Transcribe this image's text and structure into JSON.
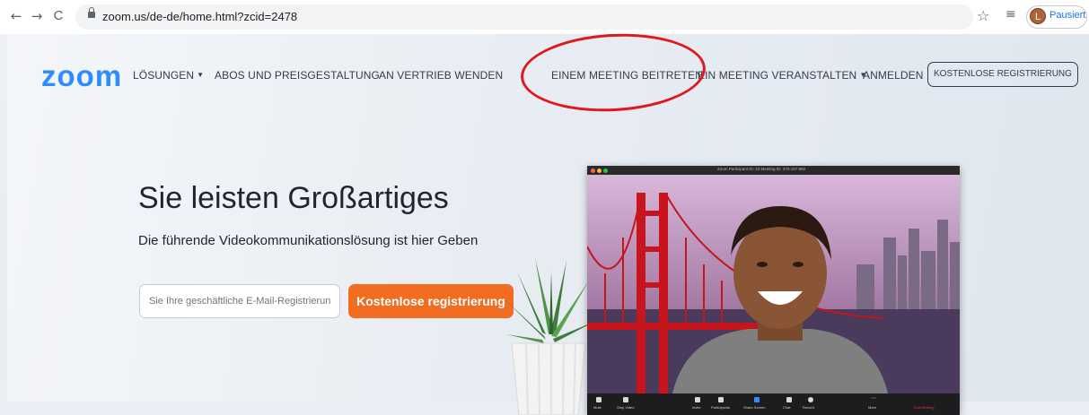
{
  "browser": {
    "back_icon": "←",
    "forward_icon": "→",
    "reload_icon": "C",
    "url": "zoom.us/de-de/home.html?zcid=2478",
    "star_icon": "☆",
    "reading_list_icon": "≡",
    "avatar_letter": "L",
    "profile_status": "Pausiert"
  },
  "header": {
    "logo": "zoom",
    "nav": [
      {
        "label": "LÖSUNGEN",
        "has_caret": true
      },
      {
        "label": "ABOS UND PREISGESTALTUNG"
      },
      {
        "label": "AN VERTRIEB WENDEN"
      },
      {
        "label": "EINEM MEETING BEITRETEN"
      },
      {
        "label": "EIN MEETING VERANSTALTEN",
        "has_caret": true
      },
      {
        "label": "ANMELDEN"
      }
    ],
    "register_button": "KOSTENLOSE REGISTRIERUNG",
    "caret": "▼"
  },
  "hero": {
    "headline": "Sie leisten Großartiges",
    "subtitle": "Die führende Videokommunikationslösung ist hier Geben",
    "email_placeholder": "Sie Ihre geschäftliche E-Mail-Registrierung",
    "cta": "Kostenlose registrierung"
  },
  "zoom_window": {
    "title": "Zoom Participant ID: 23    Meeting ID: 470-157-882",
    "toolbar": [
      {
        "label": "Mute"
      },
      {
        "label": "Stop Video"
      },
      {
        "label": "Invite"
      },
      {
        "label": "Participants"
      },
      {
        "label": "Share Screen"
      },
      {
        "label": "Chat"
      },
      {
        "label": "Record"
      },
      {
        "label": "More"
      }
    ],
    "end_meeting": "End Meeting"
  },
  "colors": {
    "brand_blue": "#2d8cff",
    "cta_orange": "#f26d21",
    "annotation_red": "#e0181b"
  }
}
